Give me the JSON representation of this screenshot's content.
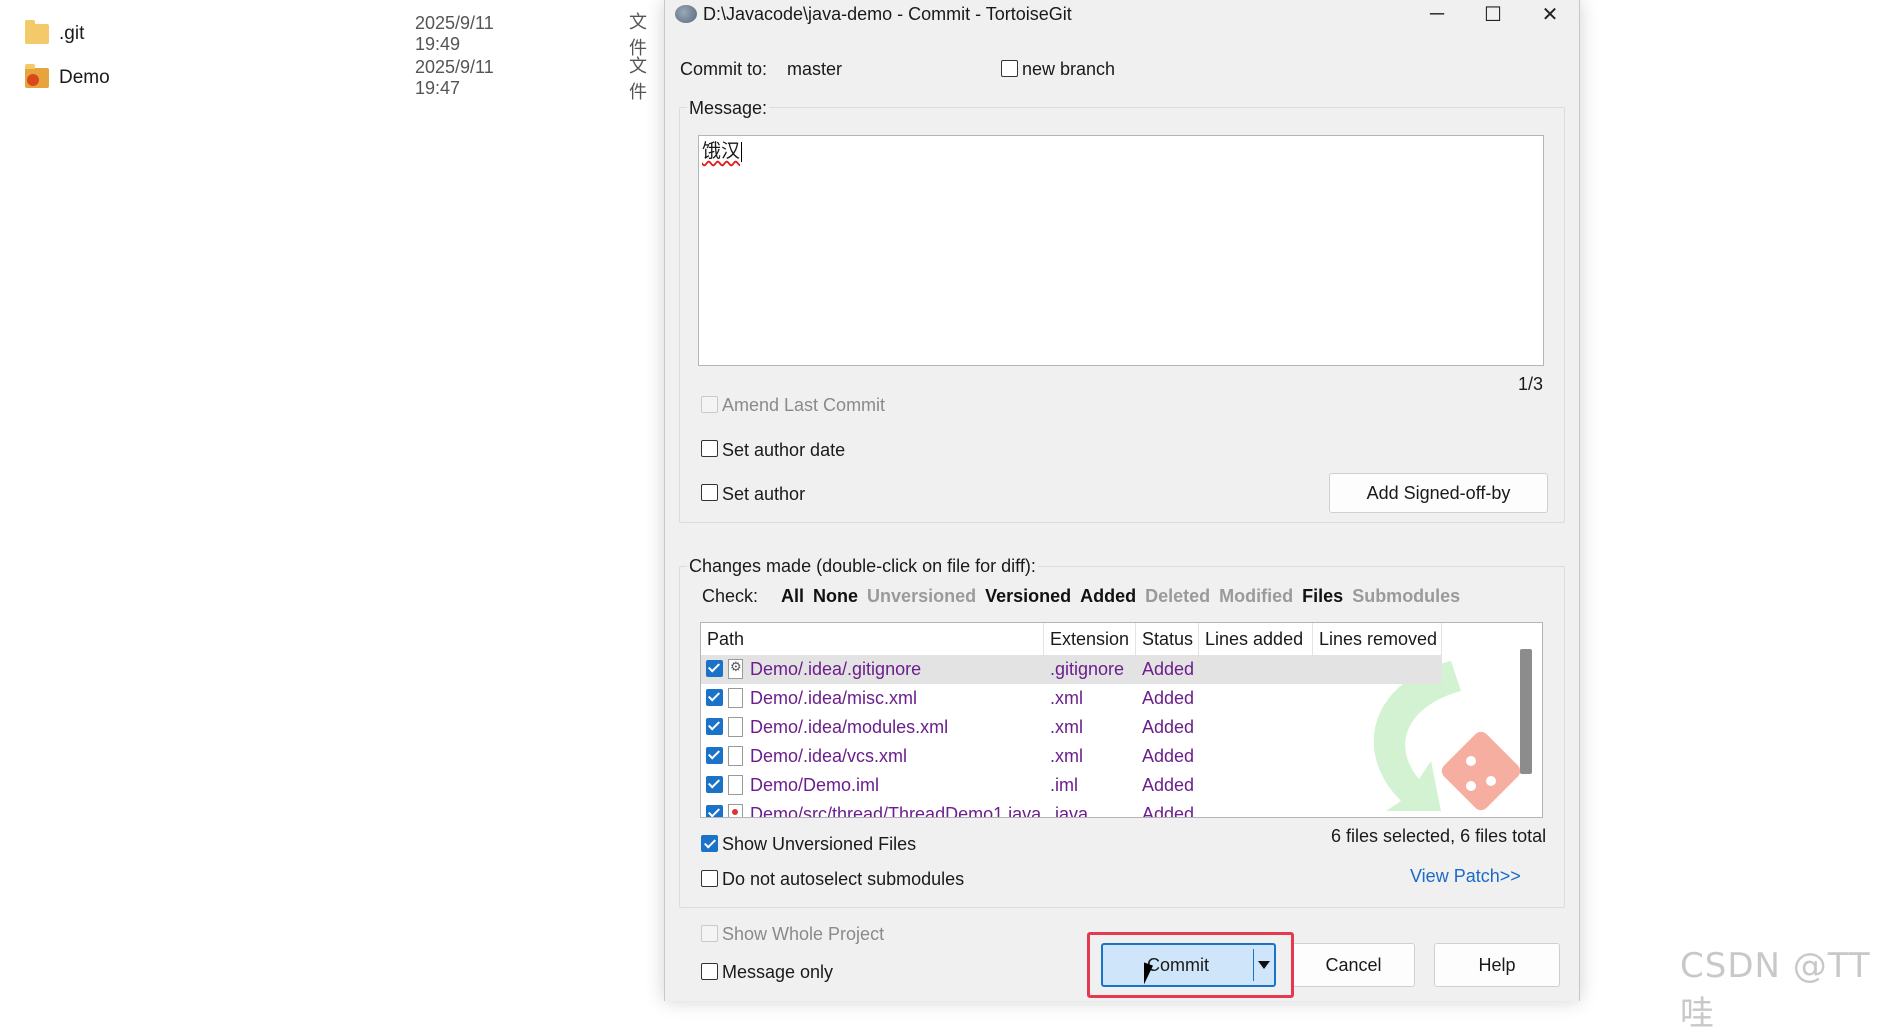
{
  "explorer": {
    "rows": [
      {
        "name": ".git",
        "date": "2025/9/11 19:49",
        "type": "文件"
      },
      {
        "name": "Demo",
        "date": "2025/9/11 19:47",
        "type": "文件"
      }
    ]
  },
  "dialog": {
    "title": "D:\\Javacode\\java-demo - Commit - TortoiseGit",
    "minimize": "─",
    "maximize": "☐",
    "close": "✕",
    "commit_to_label": "Commit to:",
    "branch": "master",
    "new_branch_label": "new branch",
    "message_label": "Message:",
    "message_text": "饿汉",
    "message_counter": "1/3",
    "amend_label": "Amend Last Commit",
    "set_author_date_label": "Set author date",
    "set_author_label": "Set author",
    "add_signed_off_label": "Add Signed-off-by",
    "changes_label": "Changes made (double-click on file for diff):",
    "check_label": "Check:",
    "filters": [
      {
        "label": "All",
        "active": true
      },
      {
        "label": "None",
        "active": true
      },
      {
        "label": "Unversioned",
        "active": false
      },
      {
        "label": "Versioned",
        "active": true
      },
      {
        "label": "Added",
        "active": true
      },
      {
        "label": "Deleted",
        "active": false
      },
      {
        "label": "Modified",
        "active": false
      },
      {
        "label": "Files",
        "active": true
      },
      {
        "label": "Submodules",
        "active": false
      }
    ],
    "columns": [
      "Path",
      "Extension",
      "Status",
      "Lines added",
      "Lines removed"
    ],
    "files": [
      {
        "path": "Demo/.idea/.gitignore",
        "ext": ".gitignore",
        "status": "Added"
      },
      {
        "path": "Demo/.idea/misc.xml",
        "ext": ".xml",
        "status": "Added"
      },
      {
        "path": "Demo/.idea/modules.xml",
        "ext": ".xml",
        "status": "Added"
      },
      {
        "path": "Demo/.idea/vcs.xml",
        "ext": ".xml",
        "status": "Added"
      },
      {
        "path": "Demo/Demo.iml",
        "ext": ".iml",
        "status": "Added"
      },
      {
        "path": "Demo/src/thread/ThreadDemo1.java",
        "ext": ".java",
        "status": "Added"
      }
    ],
    "show_unversioned_label": "Show Unversioned Files",
    "files_summary": "6 files selected, 6 files total",
    "no_autoselect_label": "Do not autoselect submodules",
    "view_patch_label": "View Patch>>",
    "show_whole_project_label": "Show Whole Project",
    "message_only_label": "Message only",
    "commit_label": "Commit",
    "cancel_label": "Cancel",
    "help_label": "Help"
  },
  "watermark": "CSDN @TT哇",
  "colors": {
    "accent": "#1a73c8",
    "file_text": "#6b1e8c",
    "highlight_outline": "#e43a4f"
  }
}
